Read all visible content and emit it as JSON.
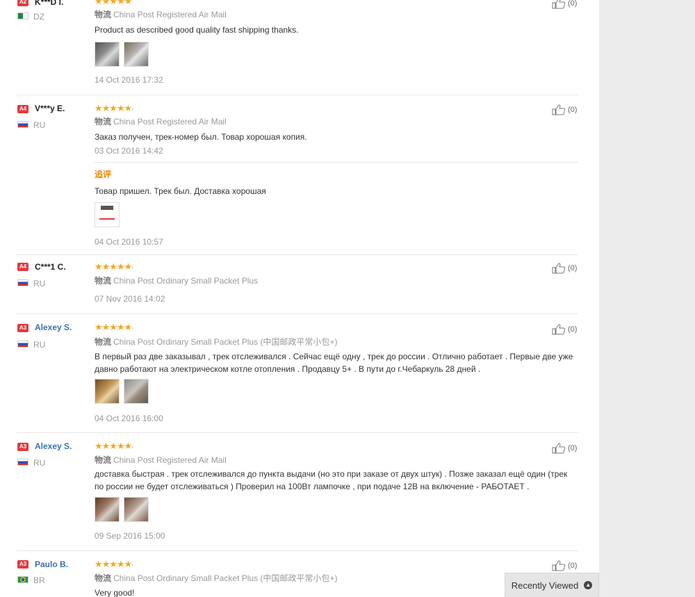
{
  "colors": {
    "star": "#f5a623",
    "level_badge": "#e4393c",
    "username_link": "#3a6fb3",
    "followup": "#f08200",
    "sidebar": "#ececec"
  },
  "shipping_label": "物流",
  "followup_label": "追评",
  "reviews": [
    {
      "level": "A2",
      "name": "K***D I.",
      "country": "DZ",
      "stars": "★★★★★",
      "shipping": "China Post Registered Air Mail",
      "text": "Product as described good quality fast shipping thanks.",
      "date": "14 Oct 2016 17:32",
      "helpful": "(0)"
    },
    {
      "level": "A4",
      "name": "V***y E.",
      "country": "RU",
      "stars": "★★★★★",
      "shipping": "China Post Registered Air Mail",
      "text": "Заказ получен, трек-номер был. Товар хорошая копия.",
      "date": "03 Oct 2016 14:42",
      "helpful": "(0)",
      "followup_text": "Товар пришел. Трек был. Доставка хорошая",
      "followup_date": "04 Oct 2016 10:57"
    },
    {
      "level": "A4",
      "name": "C***1 C.",
      "country": "RU",
      "stars": "★★★★★",
      "shipping": "China Post Ordinary Small Packet Plus",
      "date": "07 Nov 2016 14:02",
      "helpful": "(0)"
    },
    {
      "level": "A3",
      "name": "Alexey S.",
      "country": "RU",
      "stars": "★★★★★",
      "shipping": "China Post Ordinary Small Packet Plus (中国邮政平常小包+)",
      "text": "В первый раз две заказывал , трек отслеживался . Сейчас ещё одну , трек до россии . Отлично работает . Первые две уже давно работают на электрическом котле отопления . Продавцу 5+ . В пути до г.Чебаркуль 28 дней .",
      "date": "04 Oct 2016 16:00",
      "helpful": "(0)"
    },
    {
      "level": "A3",
      "name": "Alexey S.",
      "country": "RU",
      "stars": "★★★★★",
      "shipping": "China Post Registered Air Mail",
      "text": "доставка быстрая . трек отслеживался до пункта выдачи (но это при заказе от двух штук) . Позже заказал ещё один (трек по россии не будет отслеживаться ) Проверил на 100Вт лампочке , при подаче 12В на включение - РАБОТАЕТ .",
      "date": "09 Sep 2016 15:00",
      "helpful": "(0)"
    },
    {
      "level": "A3",
      "name": "Paulo B.",
      "country": "BR",
      "stars": "★★★★★",
      "shipping": "China Post Ordinary Small Packet Plus (中国邮政平常小包+)",
      "text": "Very good!",
      "helpful": "(0)"
    }
  ],
  "recently_viewed": "Recently Viewed"
}
